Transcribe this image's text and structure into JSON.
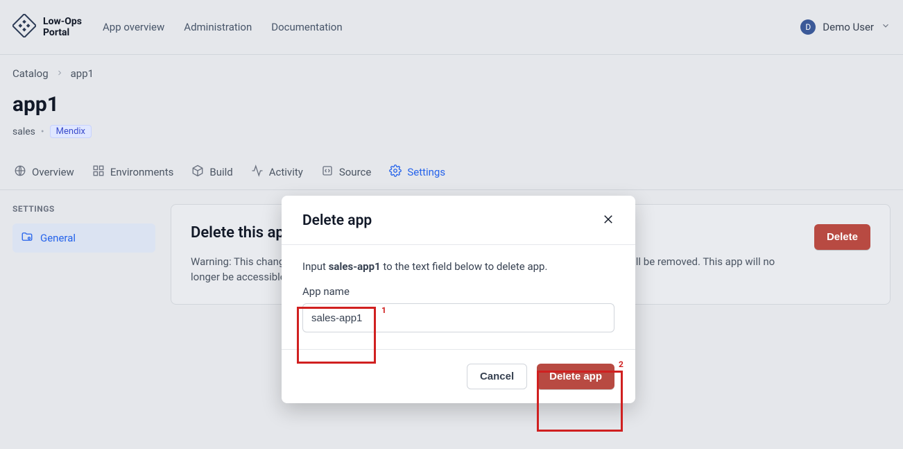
{
  "header": {
    "brand_line1": "Low-Ops",
    "brand_line2": "Portal",
    "nav": {
      "overview": "App overview",
      "admin": "Administration",
      "docs": "Documentation"
    },
    "user_initial": "D",
    "user_name": "Demo User"
  },
  "breadcrumb": {
    "root": "Catalog",
    "current": "app1"
  },
  "page": {
    "title": "app1",
    "owner": "sales",
    "tag": "Mendix"
  },
  "tabs": {
    "overview": "Overview",
    "environments": "Environments",
    "build": "Build",
    "activity": "Activity",
    "source": "Source",
    "settings": "Settings"
  },
  "settings_sidebar": {
    "heading": "SETTINGS",
    "general": "General"
  },
  "delete_card": {
    "title": "Delete this app",
    "text": "Warning: This change is permanent and cannot be undone. All associated cloud environments will be removed. This app will no longer be accessible by you or other team members.",
    "button": "Delete"
  },
  "modal": {
    "title": "Delete app",
    "instruction_prefix": "Input ",
    "instruction_bold": "sales-app1",
    "instruction_suffix": " to the text field below to delete app.",
    "field_label": "App name",
    "input_value": "sales-app1",
    "cancel": "Cancel",
    "confirm": "Delete app"
  },
  "annotations": {
    "one": "1",
    "two": "2"
  }
}
